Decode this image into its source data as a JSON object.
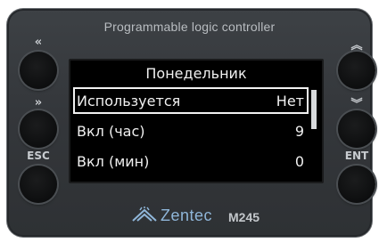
{
  "device": {
    "title": "Programmable logic controller",
    "brand": "Zentec",
    "model": "M245"
  },
  "buttons": {
    "left_top": {
      "label": "«",
      "icon": "double-left-icon"
    },
    "left_mid": {
      "label": "»",
      "icon": "double-right-icon"
    },
    "left_bottom": {
      "label": "ESC"
    },
    "right_top": {
      "label": "︽",
      "icon": "double-up-icon"
    },
    "right_mid": {
      "label": "︾",
      "icon": "double-down-icon"
    },
    "right_bottom": {
      "label": "ENT"
    }
  },
  "screen": {
    "title": "Понедельник",
    "rows": [
      {
        "name": "Используется",
        "value": "Нет",
        "selected": true
      },
      {
        "name": "Вкл (час)",
        "value": "9"
      },
      {
        "name": "Вкл (мин)",
        "value": "0"
      }
    ],
    "scroll_position": 0.0
  },
  "colors": {
    "body": "#34373b",
    "screen_bg": "#000000",
    "screen_text": "#f0f0f0",
    "brand": "#8fb6d9"
  }
}
